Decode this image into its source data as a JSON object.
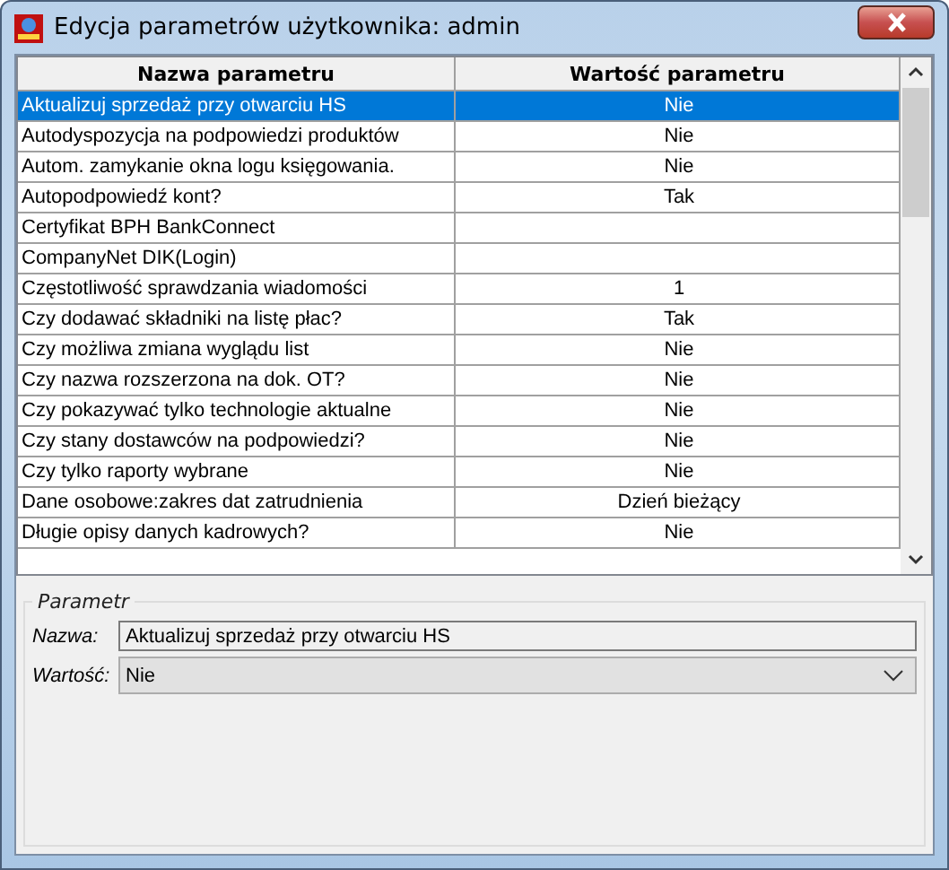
{
  "window": {
    "title": "Edycja parametrów użytkownika: admin"
  },
  "table": {
    "columns": [
      "Nazwa parametru",
      "Wartość parametru"
    ],
    "rows": [
      {
        "name": "Aktualizuj sprzedaż przy otwarciu HS",
        "value": "Nie",
        "selected": true
      },
      {
        "name": "Autodyspozycja na podpowiedzi produktów",
        "value": "Nie",
        "selected": false
      },
      {
        "name": "Autom. zamykanie okna logu księgowania.",
        "value": "Nie",
        "selected": false
      },
      {
        "name": "Autopodpowiedź kont?",
        "value": "Tak",
        "selected": false
      },
      {
        "name": "Certyfikat BPH BankConnect",
        "value": "",
        "selected": false
      },
      {
        "name": "CompanyNet DIK(Login)",
        "value": "",
        "selected": false
      },
      {
        "name": "Częstotliwość sprawdzania wiadomości",
        "value": "1",
        "selected": false
      },
      {
        "name": "Czy dodawać składniki na listę płac?",
        "value": "Tak",
        "selected": false
      },
      {
        "name": "Czy możliwa zmiana wyglądu list",
        "value": "Nie",
        "selected": false
      },
      {
        "name": "Czy nazwa rozszerzona na dok. OT?",
        "value": "Nie",
        "selected": false
      },
      {
        "name": "Czy pokazywać tylko technologie aktualne",
        "value": "Nie",
        "selected": false
      },
      {
        "name": "Czy stany dostawców na podpowiedzi?",
        "value": "Nie",
        "selected": false
      },
      {
        "name": "Czy tylko raporty wybrane",
        "value": "Nie",
        "selected": false
      },
      {
        "name": "Dane osobowe:zakres dat zatrudnienia",
        "value": "Dzień bieżący",
        "selected": false
      },
      {
        "name": "Długie opisy danych kadrowych?",
        "value": "Nie",
        "selected": false
      }
    ]
  },
  "parameter": {
    "title": "Parametr",
    "name_label": "Nazwa:",
    "name_value": "Aktualizuj sprzedaż przy otwarciu HS",
    "value_label": "Wartość:",
    "value_value": "Nie"
  }
}
